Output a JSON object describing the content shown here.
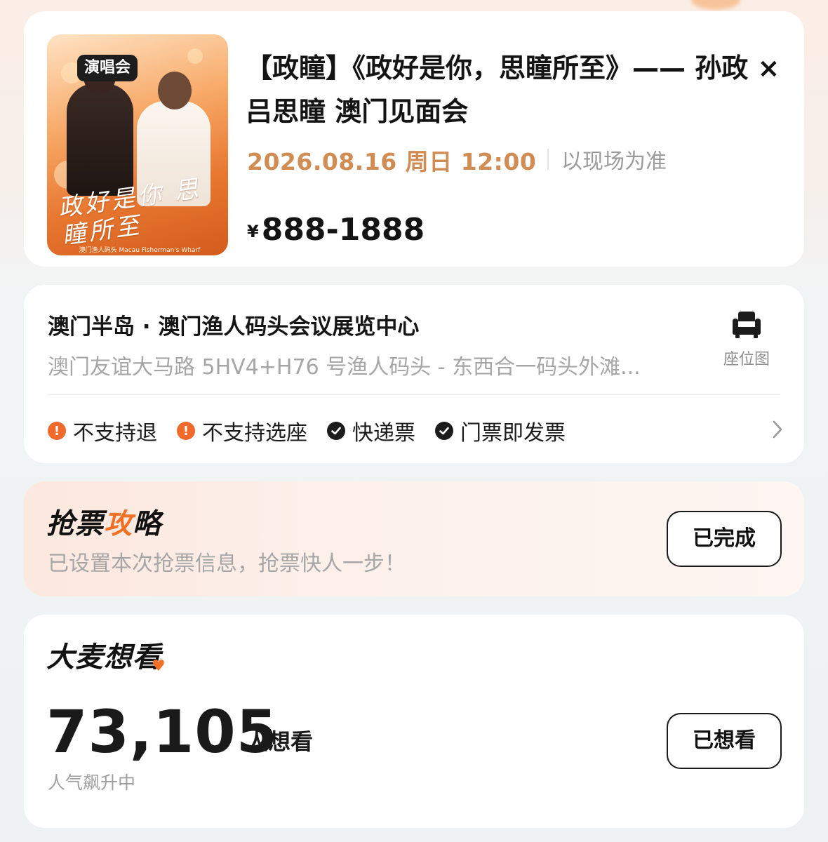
{
  "event": {
    "tag": "演唱会",
    "title": "【政瞳】《政好是你，思瞳所至》—— 孙政 × 吕思瞳 澳门见面会",
    "datetime": "2026.08.16 周日 12:00",
    "time_note": "以现场为准",
    "price_currency": "¥",
    "price_range": "888-1888",
    "poster": {
      "title_text": "政好是你 思瞳所至",
      "venue_text": "澳门渔人码头 Macau Fisherman's Wharf"
    }
  },
  "venue": {
    "name": "澳门半岛 · 澳门渔人码头会议展览中心",
    "address": "澳门友谊大马路 5HV4+H76 号渔人码头 - 东西合一码头外滩...",
    "seat_map_label": "座位图",
    "seat_map_icon": "armchair-icon",
    "policies": [
      {
        "label": "不支持退",
        "type": "warning",
        "icon": "exclamation-icon"
      },
      {
        "label": "不支持选座",
        "type": "warning",
        "icon": "exclamation-icon"
      },
      {
        "label": "快递票",
        "type": "ok",
        "icon": "check-icon"
      },
      {
        "label": "门票即发票",
        "type": "ok",
        "icon": "check-icon"
      }
    ]
  },
  "strategy": {
    "title_part1": "抢票",
    "title_accent": "攻",
    "title_part2": "略",
    "subtitle": "已设置本次抢票信息，抢票快人一步！",
    "button_label": "已完成"
  },
  "want": {
    "title_part1": "大麦想",
    "title_part2": "看",
    "count": "73,105",
    "unit": "人想看",
    "subtitle": "人气飙升中",
    "button_label": "已想看"
  },
  "colors": {
    "accent_orange": "#f07026",
    "date_orange": "#d08c52",
    "muted_gray": "#a6a6a6"
  }
}
